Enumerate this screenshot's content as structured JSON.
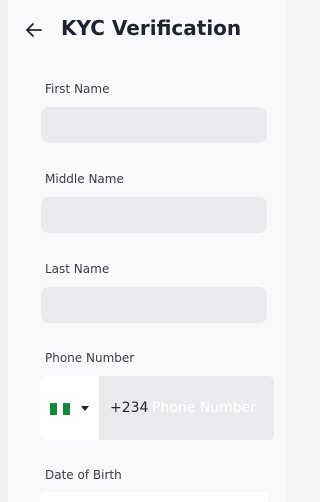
{
  "header": {
    "title": "KYC Verification",
    "back_icon": "arrow-left-icon"
  },
  "form": {
    "first_name_label": "First Name",
    "middle_name_label": "Middle Name",
    "last_name_label": "Last Name",
    "phone_label": "Phone Number",
    "phone_dial_code": "+234",
    "phone_placeholder": "Phone Number",
    "phone_country_flag": "nigeria-flag-icon",
    "dob_label": "Date of Birth"
  },
  "colors": {
    "input_background": "#ebebef",
    "page_background": "#f9f9fb",
    "flag_green": "#118a3b"
  }
}
